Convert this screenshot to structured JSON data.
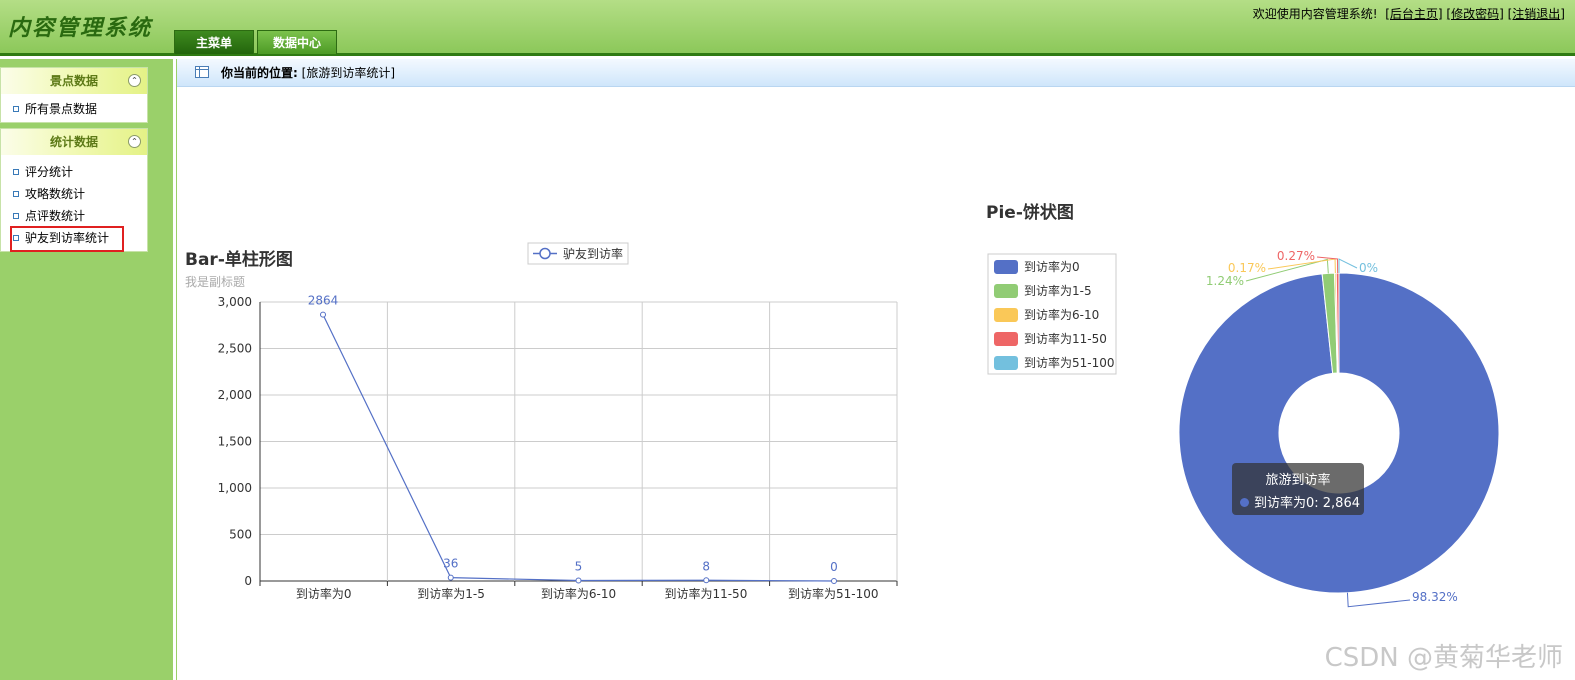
{
  "app": {
    "title": "内容管理系统",
    "welcome": "欢迎使用内容管理系统!",
    "links": [
      "[后台主页]",
      "[修改密码]",
      "[注销退出]"
    ]
  },
  "tabs": [
    {
      "label": "主菜单",
      "active": true
    },
    {
      "label": "数据中心",
      "active": false
    }
  ],
  "sidebar": {
    "panels": [
      {
        "title": "景点数据",
        "items": [
          "所有景点数据"
        ]
      },
      {
        "title": "统计数据",
        "items": [
          "评分统计",
          "攻略数统计",
          "点评数统计",
          "驴友到访率统计"
        ]
      }
    ],
    "selected_item": "驴友到访率统计"
  },
  "breadcrumb": {
    "label": "你当前的位置:",
    "value": "[旅游到访率统计]"
  },
  "line_chart": {
    "title": "Bar-单柱形图",
    "subtitle": "我是副标题",
    "legend": "驴友到访率"
  },
  "pie_chart": {
    "title": "Pie-饼状图"
  },
  "chart_data": [
    {
      "type": "line",
      "title": "Bar-单柱形图",
      "subtitle": "我是副标题",
      "categories": [
        "到访率为0",
        "到访率为1-5",
        "到访率为6-10",
        "到访率为11-50",
        "到访率为51-100"
      ],
      "series": [
        {
          "name": "驴友到访率",
          "values": [
            2864,
            36,
            5,
            8,
            0
          ],
          "color": "#5470c6"
        }
      ],
      "data_labels": [
        "2864",
        "36",
        "5",
        "8",
        "0"
      ],
      "ylim": [
        0,
        3000
      ],
      "yticks": [
        0,
        500,
        1000,
        1500,
        2000,
        2500,
        3000
      ],
      "ytick_labels": [
        "0",
        "500",
        "1,000",
        "1,500",
        "2,000",
        "2,500",
        "3,000"
      ],
      "grid": true,
      "legend_position": "top"
    },
    {
      "type": "pie",
      "title": "Pie-饼状图",
      "donut": true,
      "slices": [
        {
          "name": "到访率为0",
          "value": 2864,
          "percent_label": "98.32%",
          "color": "#5470c6"
        },
        {
          "name": "到访率为1-5",
          "value": 36,
          "percent_label": "1.24%",
          "color": "#91cc75"
        },
        {
          "name": "到访率为6-10",
          "value": 5,
          "percent_label": "0.17%",
          "color": "#fac858"
        },
        {
          "name": "到访率为11-50",
          "value": 8,
          "percent_label": "0.27%",
          "color": "#ee6666"
        },
        {
          "name": "到访率为51-100",
          "value": 0,
          "percent_label": "0%",
          "color": "#73c0de"
        }
      ],
      "legend_position": "left",
      "tooltip": {
        "title": "旅游到访率",
        "text": "到访率为0: 2,864"
      }
    }
  ],
  "watermark": "CSDN @黄菊华老师"
}
